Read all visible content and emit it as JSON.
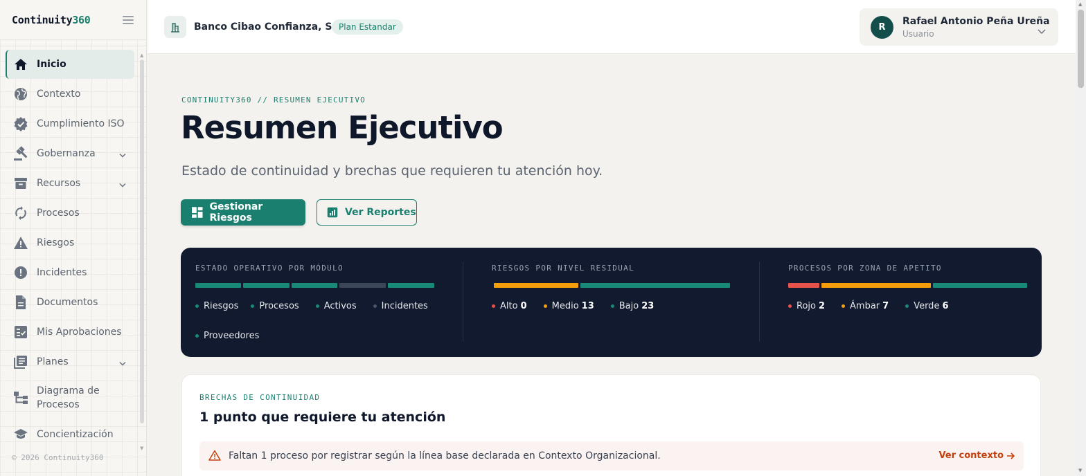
{
  "app": {
    "logo_text": "Continuity",
    "logo_num": "360"
  },
  "sidebar": {
    "items": [
      {
        "label": "Inicio",
        "icon": "home-icon",
        "active": true
      },
      {
        "label": "Contexto",
        "icon": "globe-icon"
      },
      {
        "label": "Cumplimiento ISO",
        "icon": "verified-badge-icon"
      },
      {
        "label": "Gobernanza",
        "icon": "gavel-icon",
        "expandable": true
      },
      {
        "label": "Recursos",
        "icon": "archive-icon",
        "expandable": true
      },
      {
        "label": "Procesos",
        "icon": "sync-icon"
      },
      {
        "label": "Riesgos",
        "icon": "warning-icon"
      },
      {
        "label": "Incidentes",
        "icon": "alert-circle-icon"
      },
      {
        "label": "Documentos",
        "icon": "document-icon"
      },
      {
        "label": "Mis Aprobaciones",
        "icon": "checklist-icon"
      },
      {
        "label": "Planes",
        "icon": "library-books-icon",
        "expandable": true
      },
      {
        "label": "Diagrama de Procesos",
        "icon": "flowchart-icon"
      },
      {
        "label": "Concientización",
        "icon": "school-icon"
      }
    ],
    "footer": "© 2026 Continuity360"
  },
  "header": {
    "org_name": "Banco Cibao Confianza, S.A.",
    "plan": "Plan Estandar",
    "user": {
      "initial": "R",
      "name": "Rafael Antonio Peña Ureña",
      "role": "Usuario"
    }
  },
  "main": {
    "breadcrumb": "CONTINUITY360 // RESUMEN EJECUTIVO",
    "title": "Resumen Ejecutivo",
    "subtitle": "Estado de continuidad y brechas que requieren tu atención hoy.",
    "primary_button": "Gestionar Riesgos",
    "secondary_button": "Ver Reportes"
  },
  "panel": {
    "modules": {
      "title": "ESTADO OPERATIVO POR MÓDULO",
      "legend": [
        {
          "label": "Riesgos",
          "color": "#1a8a78"
        },
        {
          "label": "Procesos",
          "color": "#1a8a78"
        },
        {
          "label": "Activos",
          "color": "#1a8a78"
        },
        {
          "label": "Incidentes",
          "color": "#4a5568"
        },
        {
          "label": "Proveedores",
          "color": "#1a8a78"
        }
      ]
    },
    "risks": {
      "title": "RIESGOS POR NIVEL RESIDUAL",
      "legend": [
        {
          "label": "Alto",
          "value": "0",
          "color": "#e5534b"
        },
        {
          "label": "Medio",
          "value": "13",
          "color": "#f59e0b"
        },
        {
          "label": "Bajo",
          "value": "23",
          "color": "#1a8a78"
        }
      ]
    },
    "appetite": {
      "title": "PROCESOS POR ZONA DE APETITO",
      "legend": [
        {
          "label": "Rojo",
          "value": "2",
          "color": "#e5534b"
        },
        {
          "label": "Ámbar",
          "value": "7",
          "color": "#f59e0b"
        },
        {
          "label": "Verde",
          "value": "6",
          "color": "#1a8a78"
        }
      ]
    }
  },
  "gaps": {
    "eyebrow": "BRECHAS DE CONTINUIDAD",
    "title": "1 punto que requiere tu atención",
    "alert_text": "Faltan 1 proceso por registrar según la línea base declarada en Contexto Organizacional.",
    "alert_link": "Ver contexto"
  }
}
